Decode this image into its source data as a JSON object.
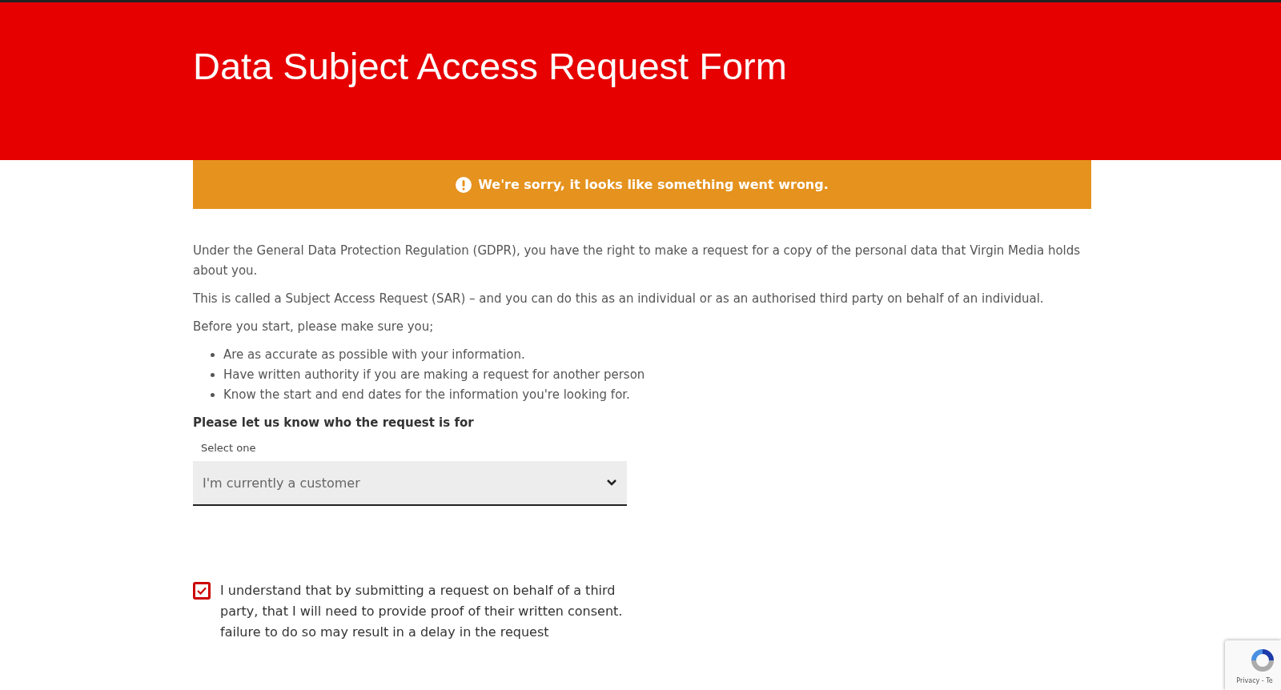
{
  "header": {
    "title": "Data Subject Access Request Form"
  },
  "alert": {
    "message": "We're sorry, it looks like something went wrong."
  },
  "intro": [
    "Under the General Data Protection Regulation (GDPR), you have the right to make a request for a copy of the personal data that Virgin Media holds about you.",
    "This is called a Subject Access Request (SAR) – and you can do this as an individual or as an authorised third party on behalf of an individual.",
    "Before you start, please make sure you;"
  ],
  "checklist": [
    "Are as accurate as possible with your information.",
    "Have written authority if you are making a request for another person",
    "Know the start and end dates for the information you're looking for."
  ],
  "request_for": {
    "question": "Please let us know who the request is for",
    "label": "Select one",
    "value": "I'm currently a customer"
  },
  "consent": {
    "checked": true,
    "text": "I understand that by submitting a request on behalf of a third party, that I will need to provide proof of their written consent. failure to do so may result in a delay in the request"
  },
  "recaptcha": {
    "text": "Privacy - Te"
  }
}
